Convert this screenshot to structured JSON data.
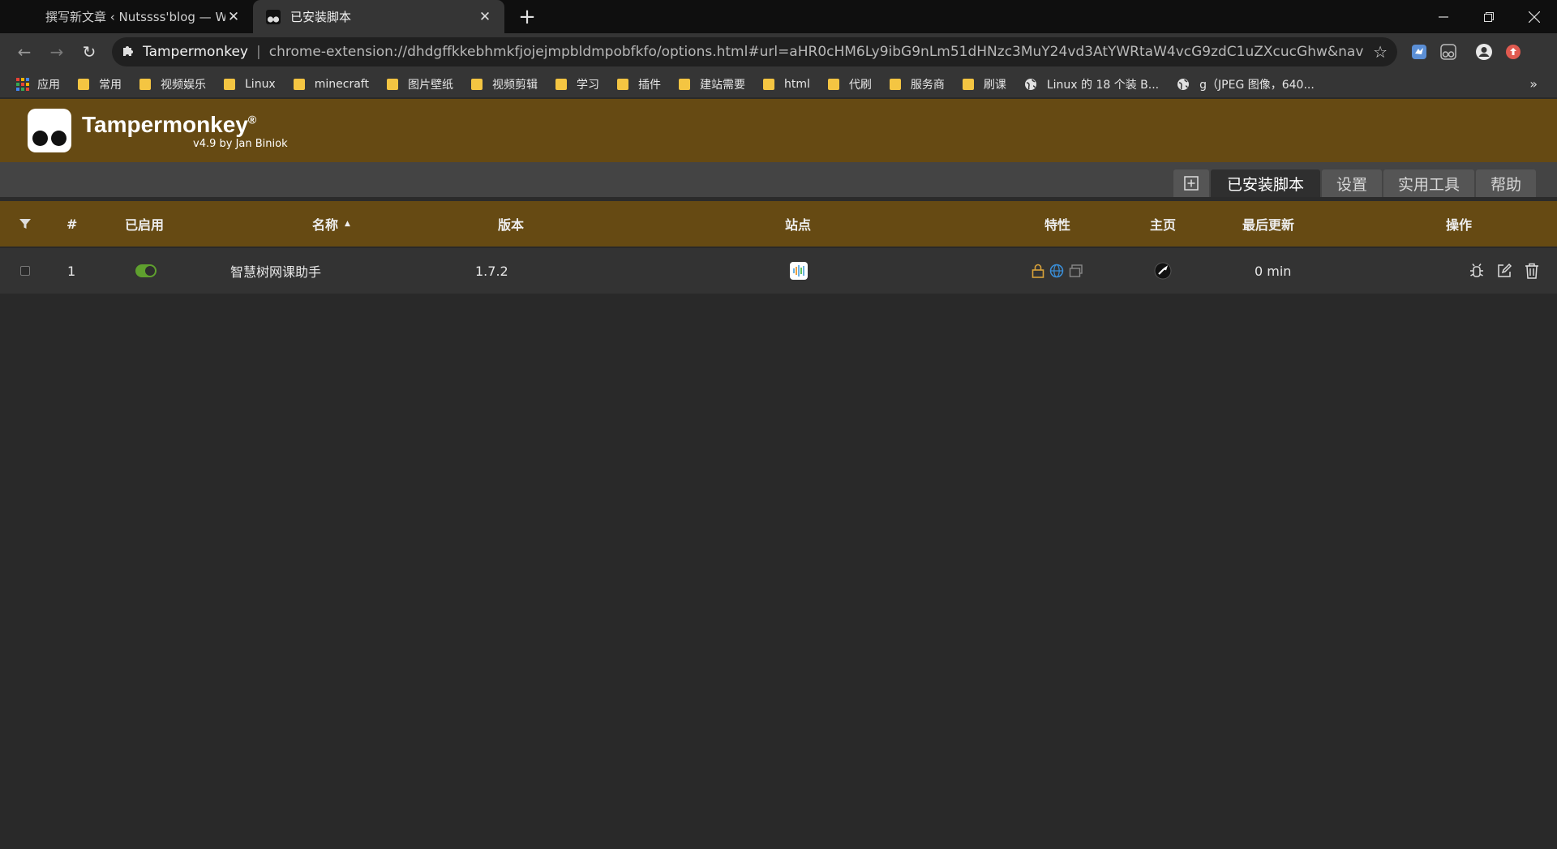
{
  "browser": {
    "tabs": [
      {
        "title": "撰写新文章 ‹ Nutssss'blog — Wo",
        "active": false
      },
      {
        "title": "已安装脚本",
        "active": true
      }
    ],
    "address": {
      "site": "Tampermonkey",
      "url": "chrome-extension://dhdgffkkebhmkfjojejmpbldmpobfkfo/options.html#url=aHR0cHM6Ly9ibG9nLm51dHNzc3MuY24vd3AtYWRtaW4vcG9zdC1uZXcucGhw&nav=dashboard"
    },
    "bookmarks": {
      "apps_label": "应用",
      "folders": [
        "常用",
        "视频娱乐",
        "Linux",
        "minecraft",
        "图片壁纸",
        "视频剪辑",
        "学习",
        "插件",
        "建站需要",
        "html",
        "代刷",
        "服务商",
        "刷课"
      ],
      "links": [
        "Linux 的 18 个装 B...",
        "g（JPEG 图像，640..."
      ],
      "more": "»"
    }
  },
  "tampermonkey": {
    "name": "Tampermonkey",
    "reg": "®",
    "version": "v4.9 by Jan Biniok",
    "nav": {
      "add_icon": "add-script-icon",
      "tabs": [
        "已安装脚本",
        "设置",
        "实用工具",
        "帮助"
      ],
      "active": "已安装脚本"
    },
    "table": {
      "headers": {
        "filter_icon": "filter-icon",
        "num": "#",
        "enabled": "已启用",
        "name": "名称",
        "version": "版本",
        "sites": "站点",
        "features": "特性",
        "homepage": "主页",
        "updated": "最后更新",
        "actions": "操作"
      },
      "rows": [
        {
          "num": "1",
          "enabled": true,
          "name": "智慧树网课助手",
          "version": "1.7.2",
          "updated": "0 min"
        }
      ]
    }
  },
  "colors": {
    "accent": "#664a13",
    "toggle_on": "#5fa02e",
    "feature_lock": "#d9a23a",
    "feature_globe": "#3a8fd9"
  }
}
